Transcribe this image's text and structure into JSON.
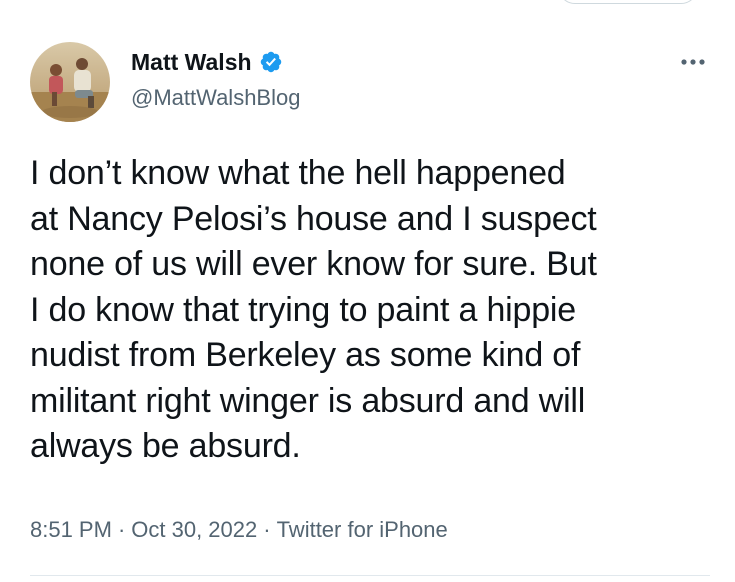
{
  "author": {
    "name": "Matt Walsh",
    "handle": "@MattWalshBlog",
    "verified": true,
    "verified_color": "#1d9bf0"
  },
  "more_menu": {
    "icon": "more-horizontal-icon"
  },
  "tweet": {
    "text": "I don’t know what the hell happened\nat Nancy Pelosi’s house and I suspect\nnone of us will ever know for sure. But\nI do know that trying to paint a hippie\nnudist from Berkeley as some kind of\nmilitant right winger is absurd and will\nalways be absurd."
  },
  "meta": {
    "time": "8:51 PM",
    "separator": "·",
    "date": "Oct 30, 2022",
    "source": "Twitter for iPhone"
  },
  "colors": {
    "text": "#0f1419",
    "secondary": "#536471",
    "accent": "#1d9bf0"
  }
}
